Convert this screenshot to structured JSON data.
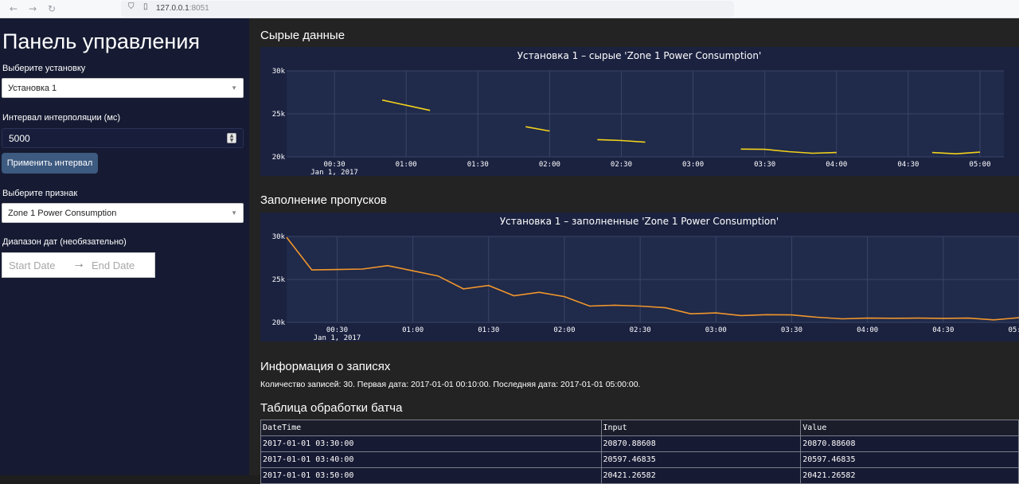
{
  "browser": {
    "url_host": "127.0.0.1",
    "url_port": ":8051"
  },
  "sidebar": {
    "title": "Панель управления",
    "plant_label": "Выберите установку",
    "plant_value": "Установка 1",
    "interval_label": "Интервал интерполяции (мс)",
    "interval_value": "5000",
    "apply_label": "Применить интервал",
    "feature_label": "Выберите признак",
    "feature_value": "Zone 1 Power Consumption",
    "date_label": "Диапазон дат (необязательно)",
    "start_placeholder": "Start Date",
    "end_placeholder": "End Date",
    "date_arrow": "→"
  },
  "main": {
    "raw_header": "Сырые данные",
    "filled_header": "Заполнение пропусков",
    "info_header": "Информация о записях",
    "info_text": "Количество записей: 30. Первая дата: 2017-01-01 00:10:00. Последняя дата: 2017-01-01 05:00:00.",
    "table_header": "Таблица обработки батча"
  },
  "table": {
    "columns": [
      "DateTime",
      "Input",
      "Value"
    ],
    "rows": [
      [
        "2017-01-01 03:30:00",
        "20870.88608",
        "20870.88608"
      ],
      [
        "2017-01-01 03:40:00",
        "20597.46835",
        "20597.46835"
      ],
      [
        "2017-01-01 03:50:00",
        "20421.26582",
        "20421.26582"
      ]
    ]
  },
  "colors": {
    "raw_line": "#f2d21b",
    "filled_line": "#f0962c",
    "plot_bg": "#202a4a",
    "paper_bg": "#1b2240"
  },
  "chart_data": [
    {
      "type": "line",
      "title": "Установка 1 – сырые 'Zone 1 Power Consumption'",
      "x_ticks": [
        "00:30",
        "01:00",
        "01:30",
        "02:00",
        "02:30",
        "03:00",
        "03:30",
        "04:00",
        "04:30",
        "05:00"
      ],
      "x_date_label": "Jan 1, 2017",
      "y_ticks": [
        "20k",
        "25k",
        "30k"
      ],
      "ylim": [
        20000,
        30000
      ],
      "xlim": [
        "2017-01-01 00:10",
        "2017-01-01 05:10"
      ],
      "series": [
        {
          "segments": [
            [
              [
                "00:50",
                26600
              ],
              [
                "01:00",
                26000
              ],
              [
                "01:10",
                25400
              ]
            ],
            [
              [
                "01:50",
                23500
              ],
              [
                "02:00",
                23000
              ]
            ],
            [
              [
                "02:20",
                22000
              ],
              [
                "02:30",
                21900
              ],
              [
                "02:40",
                21700
              ]
            ],
            [
              [
                "03:20",
                20900
              ],
              [
                "03:30",
                20870
              ],
              [
                "03:40",
                20600
              ],
              [
                "03:50",
                20420
              ],
              [
                "04:00",
                20500
              ]
            ],
            [
              [
                "04:40",
                20500
              ],
              [
                "04:50",
                20350
              ],
              [
                "05:00",
                20550
              ]
            ]
          ]
        }
      ]
    },
    {
      "type": "line",
      "title": "Установка 1 – заполненные 'Zone 1 Power Consumption'",
      "x_ticks": [
        "00:30",
        "01:00",
        "01:30",
        "02:00",
        "02:30",
        "03:00",
        "03:30",
        "04:00",
        "04:30",
        "05:00"
      ],
      "x_date_label": "Jan 1, 2017",
      "y_ticks": [
        "20k",
        "25k",
        "30k"
      ],
      "ylim": [
        20000,
        30000
      ],
      "xlim": [
        "2017-01-01 00:10",
        "2017-01-01 05:00"
      ],
      "series": [
        {
          "segments": [
            [
              [
                "00:10",
                29900
              ],
              [
                "00:20",
                26100
              ],
              [
                "00:30",
                26150
              ],
              [
                "00:40",
                26200
              ],
              [
                "00:50",
                26600
              ],
              [
                "01:00",
                26000
              ],
              [
                "01:10",
                25400
              ],
              [
                "01:20",
                23900
              ],
              [
                "01:30",
                24300
              ],
              [
                "01:40",
                23100
              ],
              [
                "01:50",
                23500
              ],
              [
                "02:00",
                23000
              ],
              [
                "02:10",
                21900
              ],
              [
                "02:20",
                22000
              ],
              [
                "02:30",
                21900
              ],
              [
                "02:40",
                21700
              ],
              [
                "02:50",
                21000
              ],
              [
                "03:00",
                21100
              ],
              [
                "03:10",
                20800
              ],
              [
                "03:20",
                20900
              ],
              [
                "03:30",
                20870
              ],
              [
                "03:40",
                20600
              ],
              [
                "03:50",
                20420
              ],
              [
                "04:00",
                20500
              ],
              [
                "04:10",
                20480
              ],
              [
                "04:20",
                20500
              ],
              [
                "04:30",
                20470
              ],
              [
                "04:40",
                20500
              ],
              [
                "04:50",
                20300
              ],
              [
                "05:00",
                20550
              ]
            ]
          ]
        }
      ]
    }
  ]
}
